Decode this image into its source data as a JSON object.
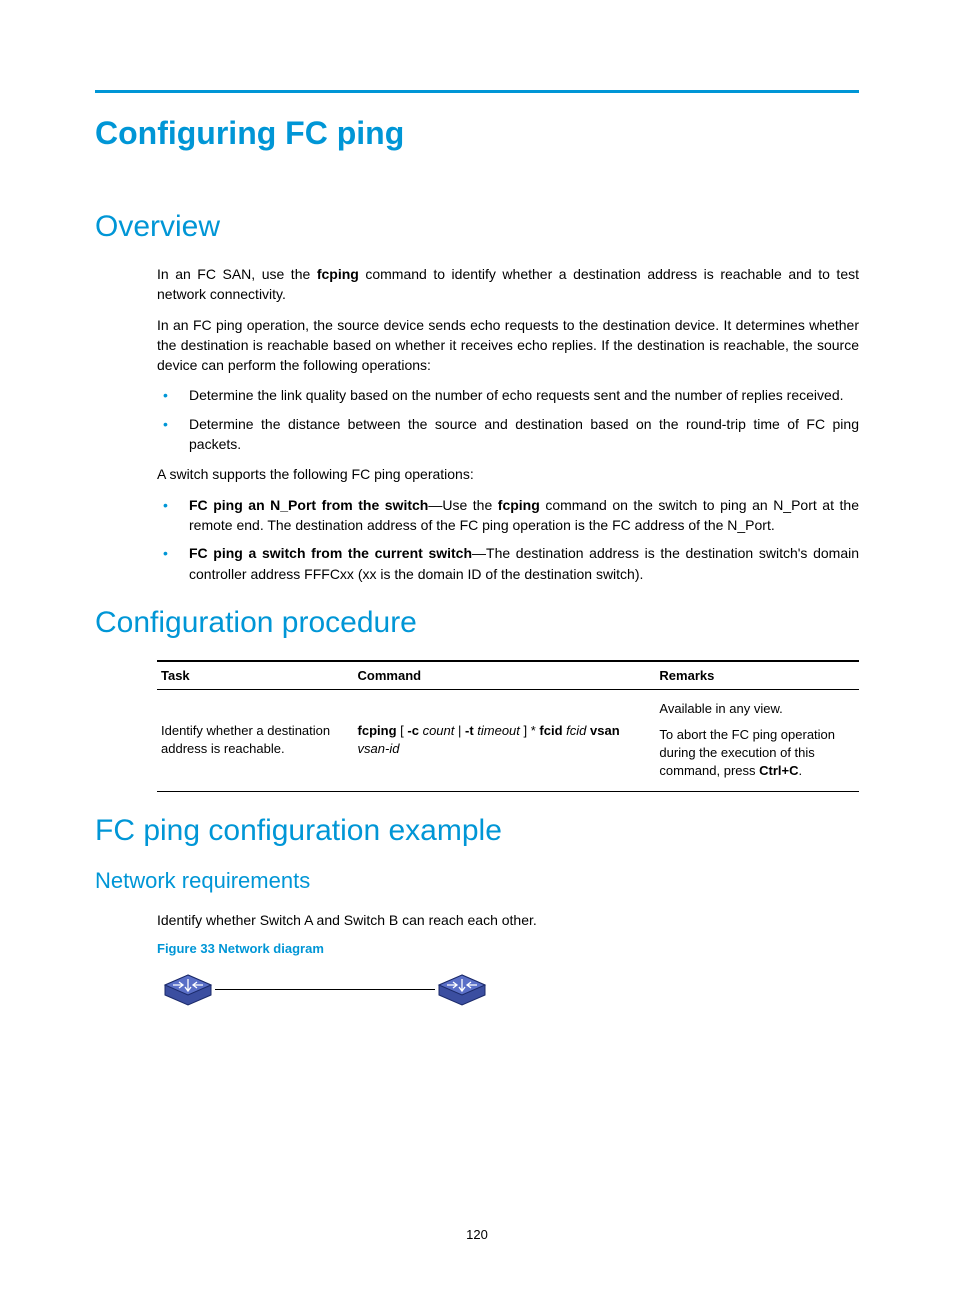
{
  "title": "Configuring FC ping",
  "overview": {
    "heading": "Overview",
    "p1_pre": "In an FC SAN, use the ",
    "p1_cmd": "fcping",
    "p1_post": " command to identify whether a destination address is reachable and to test network connectivity.",
    "p2": "In an FC ping operation, the source device sends echo requests to the destination device. It determines whether the destination is reachable based on whether it receives echo replies. If the destination is reachable, the source device can perform the following operations:",
    "bullets1": {
      "b1": "Determine the link quality based on the number of echo requests sent and the number of replies received.",
      "b2": "Determine the distance between the source and destination based on the round-trip time of FC ping packets."
    },
    "p3": "A switch supports the following FC ping operations:",
    "bullets2": {
      "b1_bold": "FC ping an N_Port from the switch",
      "b1_mid": "—Use the ",
      "b1_cmd": "fcping",
      "b1_post": " command on the switch to ping an N_Port at the remote end. The destination address of the FC ping operation is the FC address of the N_Port.",
      "b2_bold": "FC ping a switch from the current switch",
      "b2_post": "—The destination address is the destination switch's domain controller address FFFCxx (xx is the domain ID of the destination switch)."
    }
  },
  "config_proc": {
    "heading": "Configuration procedure",
    "headers": {
      "task": "Task",
      "command": "Command",
      "remarks": "Remarks"
    },
    "row": {
      "task": "Identify whether a destination address is reachable.",
      "cmd_b1": "fcping",
      "cmd_t1": " [ ",
      "cmd_b2": "-c",
      "cmd_i1": " count",
      "cmd_t2": " | ",
      "cmd_b3": "-t",
      "cmd_i2": " timeout",
      "cmd_t3": " ] * ",
      "cmd_b4": "fcid",
      "cmd_i3": " fcid ",
      "cmd_b5": "vsan",
      "cmd_i4": " vsan-id",
      "rem1": "Available in any view.",
      "rem2_a": "To abort the FC ping operation during the execution of this command, press ",
      "rem2_b": "Ctrl+C",
      "rem2_c": "."
    }
  },
  "example": {
    "heading": "FC ping configuration example",
    "sub": "Network requirements",
    "p1": "Identify whether Switch A and Switch B can reach each other.",
    "fig": "Figure 33 Network diagram"
  },
  "page": "120"
}
